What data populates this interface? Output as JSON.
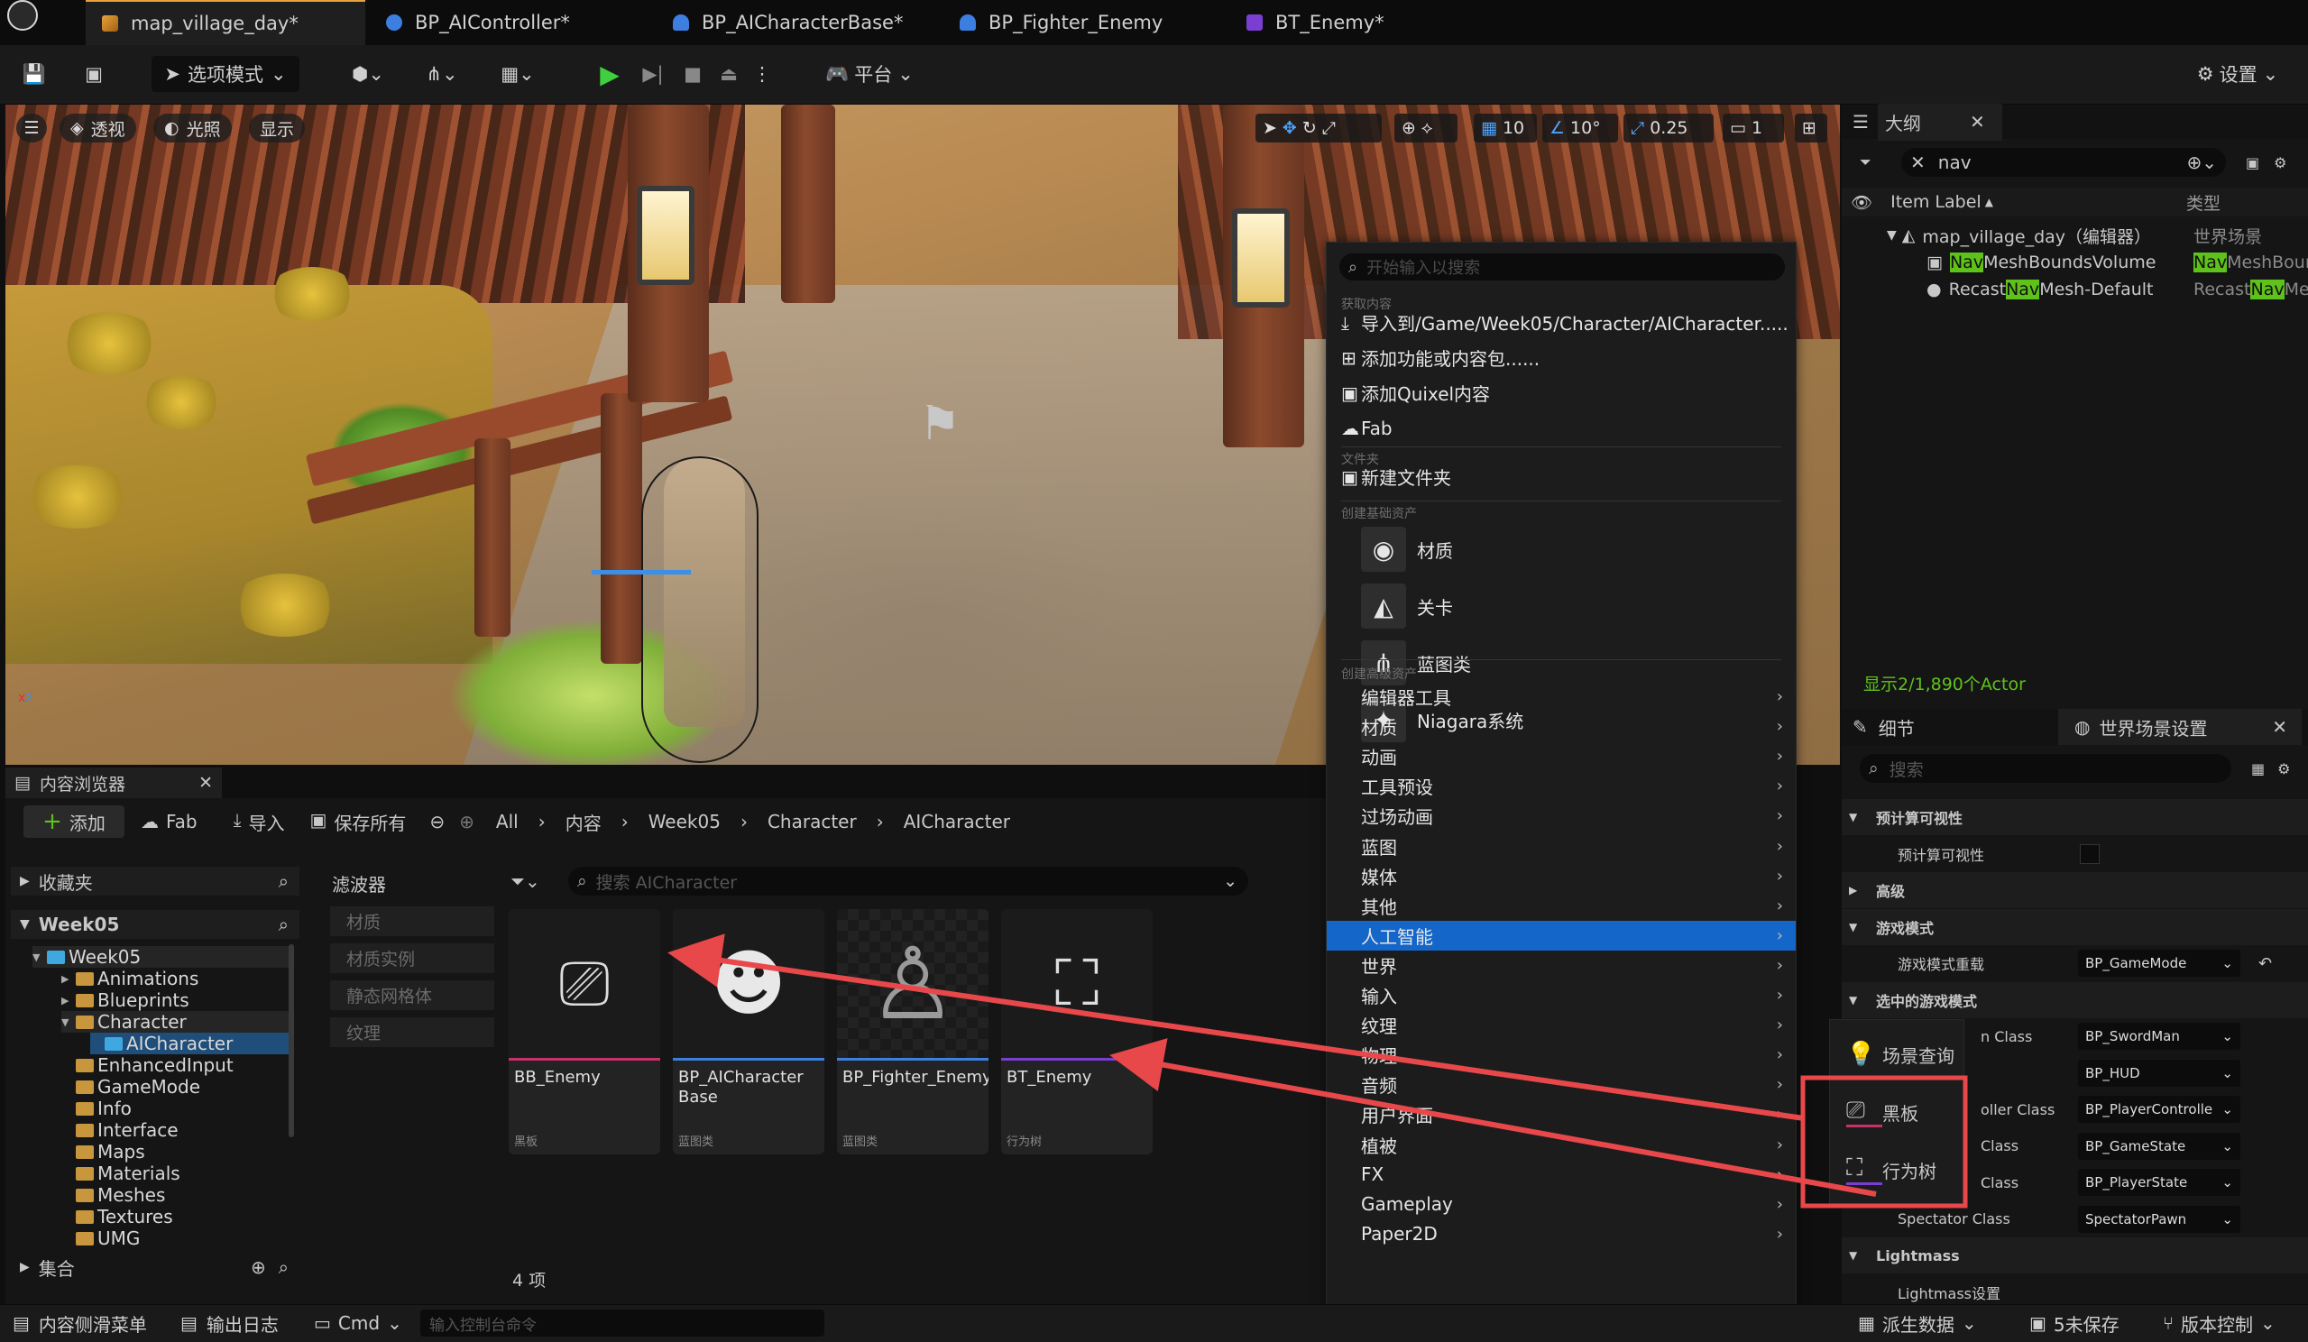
{
  "tabs": [
    "map_village_day*",
    "BP_AIController*",
    "BP_AICharacterBase*",
    "BP_Fighter_Enemy",
    "BT_Enemy*"
  ],
  "toolbar": {
    "mode": "选项模式",
    "platform": "平台",
    "settings": "设置"
  },
  "viewport": {
    "perspective": "透视",
    "lighting": "光照",
    "show": "显示",
    "grid": "10",
    "angle": "10°",
    "scale": "0.25",
    "camera": "1"
  },
  "outliner": {
    "title": "大纲",
    "search": "nav",
    "col_label": "Item Label",
    "col_type": "类型",
    "rows": [
      {
        "label": "map_village_day（编辑器）",
        "type": "世界场景"
      },
      {
        "label_hl": "Nav",
        "label_rest": "MeshBoundsVolume",
        "type_hl": "Nav",
        "type_rest": "MeshBour"
      },
      {
        "label_pre": "Recast",
        "label_hl": "Nav",
        "label_rest": "Mesh-Default",
        "type_pre": "Recast",
        "type_hl": "Nav",
        "type_rest": "Me"
      }
    ],
    "count": "显示2/1,890个Actor"
  },
  "details": {
    "tab1": "细节",
    "tab2": "世界场景设置",
    "search_placeholder": "搜索",
    "rows": [
      {
        "label": "预计算可视性",
        "section": true
      },
      {
        "label": "预计算可视性"
      },
      {
        "label": "高级",
        "section": true
      },
      {
        "label": "游戏模式",
        "section": true
      },
      {
        "label": "游戏模式重载",
        "value": "BP_GameMode"
      },
      {
        "label": "选中的游戏模式",
        "section": true
      },
      {
        "label": "n Class",
        "value": "BP_SwordMan"
      },
      {
        "label": "",
        "value": "BP_HUD"
      },
      {
        "label": "oller Class",
        "value": "BP_PlayerControlle"
      },
      {
        "label": "Class",
        "value": "BP_GameState"
      },
      {
        "label": "Class",
        "value": "BP_PlayerState"
      },
      {
        "label": "Spectator Class",
        "value": "SpectatorPawn"
      },
      {
        "label": "Lightmass",
        "section": true
      },
      {
        "label": "Lightmass设置"
      }
    ]
  },
  "content_browser": {
    "title": "内容浏览器",
    "add": "添加",
    "fab": "Fab",
    "import": "导入",
    "save_all": "保存所有",
    "breadcrumb": [
      "All",
      "内容",
      "Week05",
      "Character",
      "AICharacter"
    ],
    "favorites": "收藏夹",
    "project": "Week05",
    "filters_title": "滤波器",
    "filters": [
      "材质",
      "材质实例",
      "静态网格体",
      "纹理"
    ],
    "search_placeholder": "搜索 AICharacter",
    "tree": [
      "Week05",
      "Animations",
      "Blueprints",
      "Character",
      "AICharacter",
      "EnhancedInput",
      "GameMode",
      "Info",
      "Interface",
      "Maps",
      "Materials",
      "Meshes",
      "Textures",
      "UMG"
    ],
    "collections": "集合",
    "item_count": "4 项",
    "assets": [
      {
        "name": "BB_Enemy",
        "type": "黑板",
        "color": "#c8326a"
      },
      {
        "name": "BP_AICharacter Base",
        "type": "蓝图类",
        "color": "#3d7fe0"
      },
      {
        "name": "BP_Fighter_Enemy",
        "type": "蓝图类",
        "color": "#3d7fe0"
      },
      {
        "name": "BT_Enemy",
        "type": "行为树",
        "color": "#7a3fd0"
      }
    ]
  },
  "menu": {
    "search_placeholder": "开始输入以搜索",
    "sec_get": "获取内容",
    "get_items": [
      "导入到/Game/Week05/Character/AICharacter.....",
      "添加功能或内容包......",
      "添加Quixel内容",
      "Fab"
    ],
    "sec_folder": "文件夹",
    "new_folder": "新建文件夹",
    "sec_basic": "创建基础资产",
    "basic": [
      "材质",
      "关卡",
      "蓝图类",
      "Niagara系统"
    ],
    "sec_adv": "创建高级资产",
    "adv": [
      "编辑器工具",
      "材质",
      "动画",
      "工具预设",
      "过场动画",
      "蓝图",
      "媒体",
      "其他",
      "人工智能",
      "世界",
      "输入",
      "纹理",
      "物理",
      "音频",
      "用户界面",
      "植被",
      "FX",
      "Gameplay",
      "Paper2D"
    ],
    "active": "人工智能"
  },
  "submenu": [
    "场景查询",
    "黑板",
    "行为树"
  ],
  "status": {
    "drawer": "内容侧滑菜单",
    "log": "输出日志",
    "cmd": "Cmd",
    "cmd_placeholder": "输入控制台命令",
    "derived": "派生数据",
    "unsaved": "5未保存",
    "source": "版本控制"
  }
}
